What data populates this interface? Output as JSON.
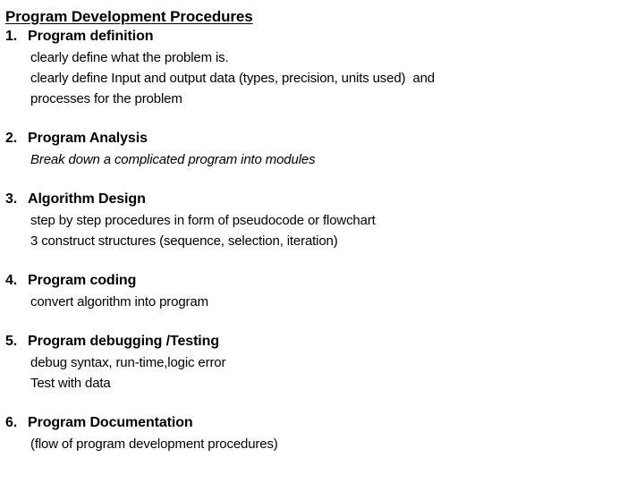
{
  "slide": {
    "title": "Program Development Procedures",
    "background_color": "#ffffff",
    "text_color": "#000000",
    "items": [
      {
        "number": "1.",
        "heading": "Program definition",
        "lines": [
          {
            "text": "clearly define what the problem is.",
            "style": "normal"
          },
          {
            "text": "clearly define Input and output data (types, precision, units used)  and",
            "style": "normal"
          },
          {
            "text": "processes for the problem",
            "style": "normal"
          }
        ]
      },
      {
        "number": "2.",
        "heading": "Program Analysis",
        "lines": [
          {
            "text": "Break down a complicated program into modules",
            "style": "italic"
          }
        ]
      },
      {
        "number": "3.",
        "heading": "Algorithm Design",
        "lines": [
          {
            "text": "step by step procedures in form of pseudocode or flowchart",
            "style": "normal"
          },
          {
            "text": "3 construct structures (sequence, selection, iteration)",
            "style": "normal"
          }
        ]
      },
      {
        "number": "4.",
        "heading": "Program coding",
        "lines": [
          {
            "text": "convert algorithm into program",
            "style": "normal"
          }
        ]
      },
      {
        "number": "5.",
        "heading": "Program debugging /Testing",
        "lines": [
          {
            "text": "debug syntax, run-time,logic error",
            "style": "normal"
          },
          {
            "text": "Test with data",
            "style": "normal"
          }
        ]
      },
      {
        "number": "6.",
        "heading": "Program Documentation",
        "lines": [
          {
            "text": "(flow of program development procedures)",
            "style": "normal"
          }
        ]
      }
    ]
  }
}
